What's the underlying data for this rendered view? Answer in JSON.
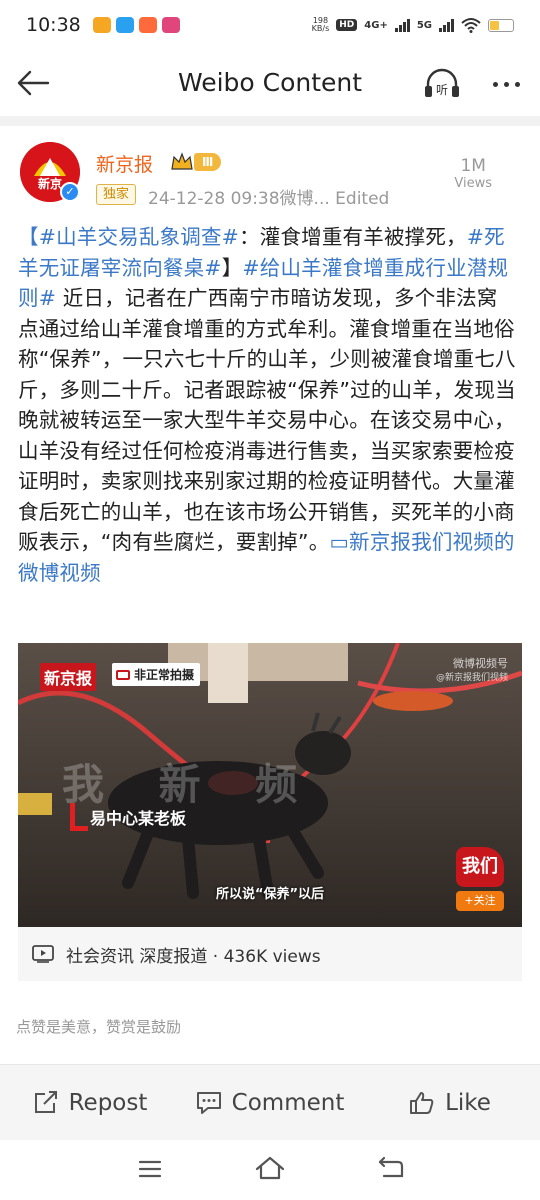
{
  "status": {
    "time": "10:38",
    "speed_value": "198",
    "speed_unit": "KB/s",
    "hd": "HD",
    "net4g": "4G+",
    "net5g": "5G",
    "battery_level": 0.45
  },
  "header": {
    "title": "Weibo Content"
  },
  "post": {
    "author": "新京报",
    "avatar_text": "新京",
    "level": "Ⅲ",
    "exclusive": "独家",
    "meta": "24-12-28 09:38微博...   Edited",
    "views": "1M",
    "views_label": "Views",
    "text": {
      "tag1": "【#山羊交易乱象调查#",
      "p1": "：灌食增重有羊被撑死，",
      "tag2": "#死羊无证屠宰流向餐桌#",
      "p2": "】",
      "tag3": "#给山羊灌食增重成行业潜规则#",
      "p3": " 近日，记者在广西南宁市暗访发现，多个非法窝点通过给山羊灌食增重的方式牟利。灌食增重在当地俗称“保养”，一只六七十斤的山羊，少则被灌食增重七八斤，多则二十斤。记者跟踪被“保养”过的山羊，发现当晚就被转运至一家大型牛羊交易中心。在该交易中心，山羊没有经过任何检疫消毒进行售卖，当买家索要检疫证明时，卖家则找来别家过期的检疫证明替代。大量灌食后死亡的山羊，也在该市场公开销售，买死羊的小商贩表示，“肉有些腐烂，要割掉”。",
      "video_link": "▭新京报我们视频的微博视频"
    },
    "video": {
      "logo": "新京报",
      "badge": "非正常拍摄",
      "watermark": "微博视频号",
      "watermark_sub": "@新京报我们视频",
      "bg_text": "我   新   频",
      "caption_tag": "易中心某老板",
      "subtitle": "所以说“保养”以后",
      "brand": "我们",
      "follow": "+关注"
    },
    "video_info": "社会资讯 深度报道 · 436K views"
  },
  "encourage": "点赞是美意，赞赏是鼓励",
  "actions": {
    "repost": "Repost",
    "comment": "Comment",
    "like": "Like"
  }
}
